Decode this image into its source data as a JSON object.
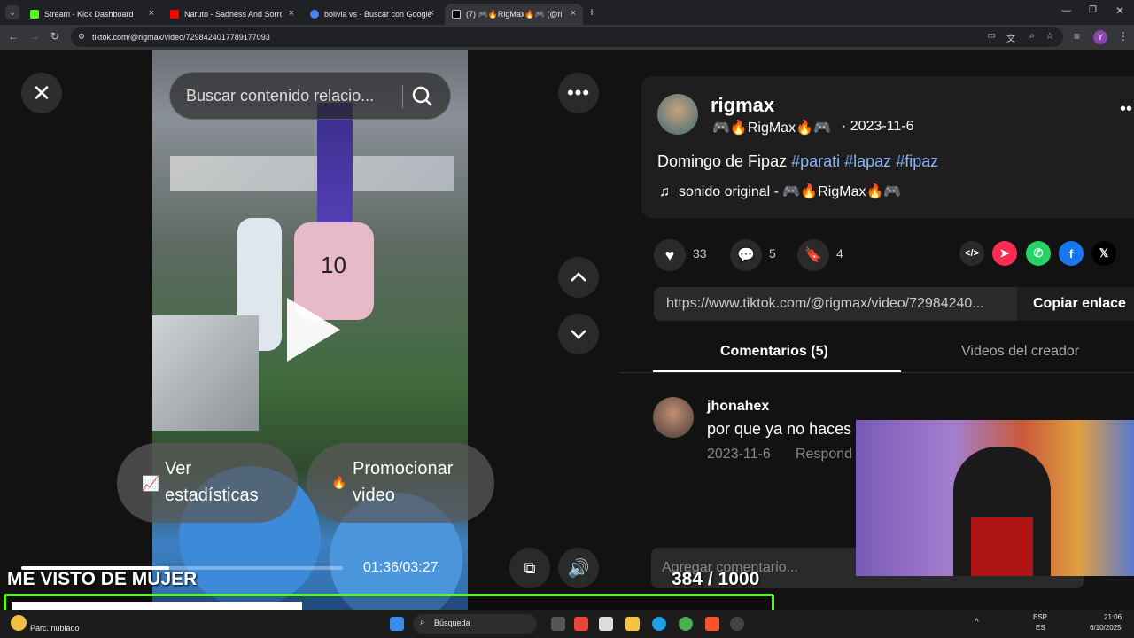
{
  "browser": {
    "tabs": [
      {
        "label": "Stream - Kick Dashboard",
        "color": "#53fc18"
      },
      {
        "label": "Naruto - Sadness And Sorrow (",
        "color": "#ff0000"
      },
      {
        "label": "bolivia vs - Buscar con Google",
        "color": "#4285f4"
      },
      {
        "label": "(7) 🎮🔥RigMax🔥🎮 (@rigma",
        "color": "#ffffff"
      }
    ],
    "url": "tiktok.com/@rigmax/video/7298424017789177093",
    "profile_initial": "Y"
  },
  "video": {
    "search_placeholder": "Buscar contenido relacio...",
    "stats_label_1": "Ver",
    "stats_label_2": "estadísticas",
    "promote_label_1": "Promocionar",
    "promote_label_2": "video",
    "time": "01:36/03:27",
    "progress": 0.46
  },
  "post": {
    "username": "rigmax",
    "display_name": "🎮🔥RigMax🔥🎮",
    "date": "· 2023-11-6",
    "caption": "Domingo de Fipaz ",
    "hashtags": [
      "#parati",
      "#lapaz",
      "#fipaz"
    ],
    "sound": "sonido original - 🎮🔥RigMax🔥🎮",
    "likes": "33",
    "comments": "5",
    "saves": "4",
    "link": "https://www.tiktok.com/@rigmax/video/72984240...",
    "copy_link": "Copiar enlace",
    "tab_comments": "Comentarios (5)",
    "tab_creator": "Videos del creador"
  },
  "comment": {
    "user": "jhonahex",
    "text": "por que ya no haces",
    "date": "2023-11-6",
    "reply": "Respond"
  },
  "add_comment_placeholder": "Agregar comentario...",
  "overlay": {
    "title": "ME VISTO DE MUJER",
    "counter": "384 / 1000",
    "accent": "#53fc18"
  },
  "taskbar": {
    "weather": "Parc. nublado",
    "search": "Búsqueda",
    "lang1": "ESP",
    "lang2": "ES",
    "time": "21:06",
    "date": "6/10/2025"
  }
}
